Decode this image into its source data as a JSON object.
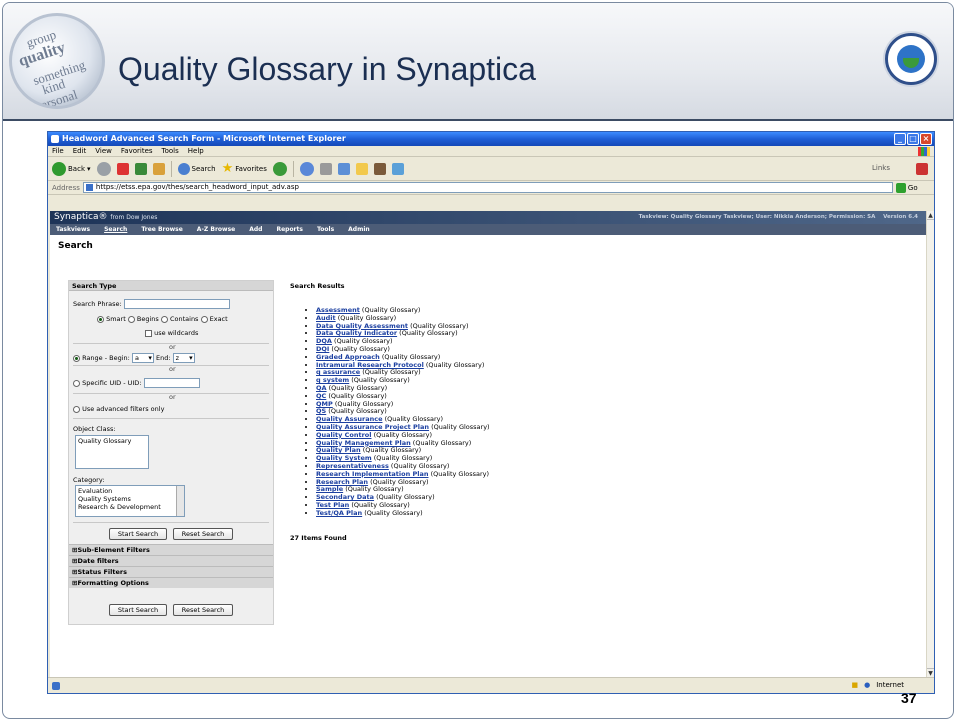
{
  "slide": {
    "title": "Quality Glossary in Synaptica",
    "page_number": "37",
    "logo_words": [
      "quality",
      "group",
      "something",
      "kind",
      "personal"
    ]
  },
  "window": {
    "title": "Headword Advanced Search Form - Microsoft Internet Explorer",
    "menu": [
      "File",
      "Edit",
      "View",
      "Favorites",
      "Tools",
      "Help"
    ],
    "toolbar": {
      "back": "Back",
      "search": "Search",
      "favorites": "Favorites",
      "links": "Links"
    },
    "address_label": "Address",
    "address": "https://etss.epa.gov/thes/search_headword_input_adv.asp",
    "go": "Go",
    "status_zone": "Internet"
  },
  "app": {
    "brand": "Synaptica®",
    "brand_from": "from Dow Jones",
    "user_info": "Taskview: Quality Glossary Taskview; User: Nikkia Anderson; Permission: SA",
    "version": "Version 6.4",
    "nav": [
      "Taskviews",
      "Search",
      "Tree Browse",
      "A-Z Browse",
      "Add",
      "Reports",
      "Tools",
      "Admin"
    ],
    "page_heading": "Search"
  },
  "search_form": {
    "section_title": "Search Type",
    "phrase_label": "Search Phrase:",
    "modes": [
      "Smart",
      "Begins",
      "Contains",
      "Exact"
    ],
    "wildcards_label": "use wildcards",
    "or": "or",
    "range_label": "Range - Begin:",
    "range_begin": "a",
    "range_end_label": "End:",
    "range_end": "z",
    "uid_label": "Specific UID - UID:",
    "advanced_label": "Use advanced filters only",
    "object_class_label": "Object Class:",
    "object_classes": [
      "Quality Glossary"
    ],
    "category_label": "Category:",
    "categories": [
      "Evaluation",
      "Quality Systems",
      "Research & Development"
    ],
    "start_button": "Start Search",
    "reset_button": "Reset Search",
    "filters": [
      "Sub-Element Filters",
      "Date filters",
      "Status Filters",
      "Formatting Options"
    ]
  },
  "results": {
    "heading": "Search Results",
    "items": [
      {
        "term": "Assessment",
        "source": "(Quality Glossary)"
      },
      {
        "term": "Audit",
        "source": "(Quality Glossary)"
      },
      {
        "term": "Data Quality Assessment",
        "source": "(Quality Glossary)"
      },
      {
        "term": "Data Quality Indicator",
        "source": "(Quality Glossary)"
      },
      {
        "term": "DQA",
        "source": "(Quality Glossary)"
      },
      {
        "term": "DQI",
        "source": "(Quality Glossary)"
      },
      {
        "term": "Graded Approach",
        "source": "(Quality Glossary)"
      },
      {
        "term": "Intramural Research Protocol",
        "source": "(Quality Glossary)"
      },
      {
        "term": "q assurance",
        "source": "(Quality Glossary)"
      },
      {
        "term": "q system",
        "source": "(Quality Glossary)"
      },
      {
        "term": "QA",
        "source": "(Quality Glossary)"
      },
      {
        "term": "QC",
        "source": "(Quality Glossary)"
      },
      {
        "term": "QMP",
        "source": "(Quality Glossary)"
      },
      {
        "term": "QS",
        "source": "(Quality Glossary)"
      },
      {
        "term": "Quality Assurance",
        "source": "(Quality Glossary)"
      },
      {
        "term": "Quality Assurance Project Plan",
        "source": "(Quality Glossary)"
      },
      {
        "term": "Quality Control",
        "source": "(Quality Glossary)"
      },
      {
        "term": "Quality Management Plan",
        "source": "(Quality Glossary)"
      },
      {
        "term": "Quality Plan",
        "source": "(Quality Glossary)"
      },
      {
        "term": "Quality System",
        "source": "(Quality Glossary)"
      },
      {
        "term": "Representativeness",
        "source": "(Quality Glossary)"
      },
      {
        "term": "Research Implementation Plan",
        "source": "(Quality Glossary)"
      },
      {
        "term": "Research Plan",
        "source": "(Quality Glossary)"
      },
      {
        "term": "Sample",
        "source": "(Quality Glossary)"
      },
      {
        "term": "Secondary Data",
        "source": "(Quality Glossary)"
      },
      {
        "term": "Test Plan",
        "source": "(Quality Glossary)"
      },
      {
        "term": "Test/QA Plan",
        "source": "(Quality Glossary)"
      }
    ],
    "count_text": "27 Items Found"
  },
  "colors": {
    "title": "#1b2f52",
    "ie_titlebar": "#1f5fd6",
    "app_header": "#1e3458",
    "link": "#1b3fa0"
  }
}
